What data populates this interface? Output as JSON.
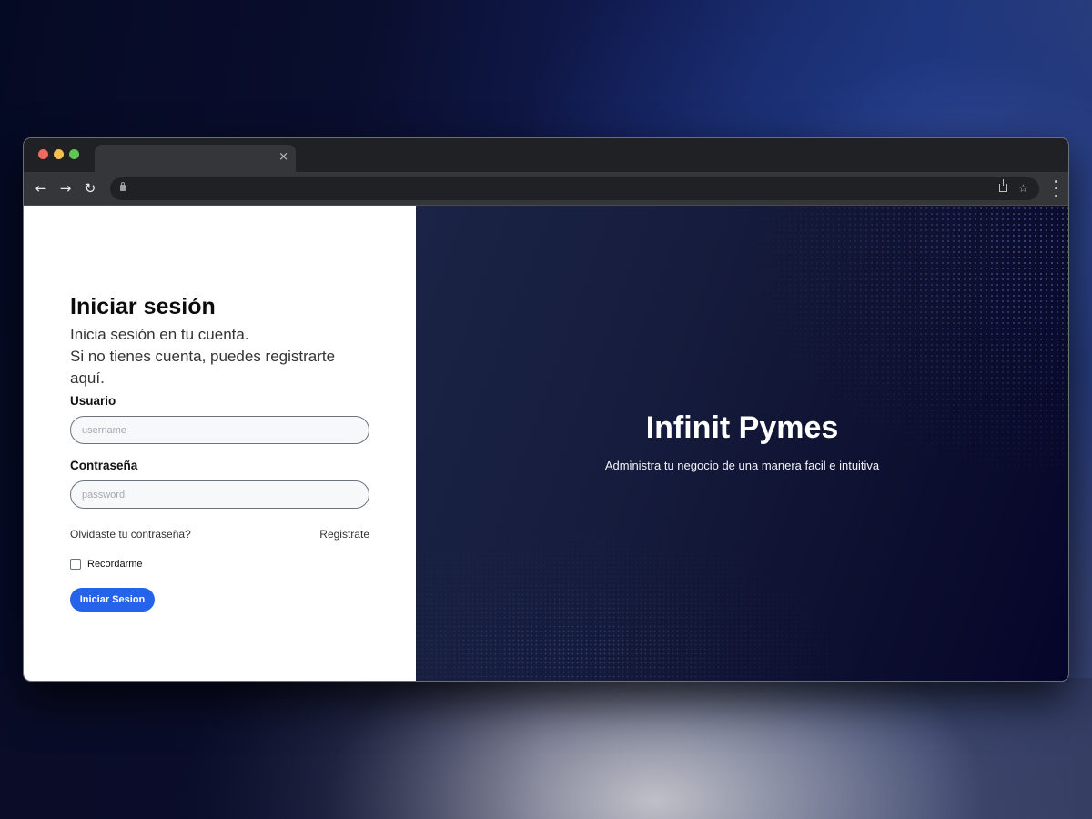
{
  "browser": {
    "tab": {
      "title": "",
      "close_icon": "×"
    },
    "nav": {
      "back_icon": "←",
      "forward_icon": "→",
      "reload_icon": "↻"
    },
    "address_bar": {
      "url": "",
      "lock_icon": "lock-icon"
    },
    "bookmark_icon": "☆"
  },
  "login": {
    "title": "Iniciar sesión",
    "subtitle_line1": "Inicia sesión en tu cuenta.",
    "subtitle_line2": "Si no tienes cuenta, puedes registrarte aquí.",
    "username_label": "Usuario",
    "username_placeholder": "username",
    "username_value": "",
    "password_label": "Contraseña",
    "password_placeholder": "password",
    "password_value": "",
    "forgot_link": "Olvidaste tu contraseña?",
    "register_link": "Registrate",
    "remember_label": "Recordarme",
    "remember_checked": false,
    "submit_label": "Iniciar Sesion"
  },
  "hero": {
    "title": "Infinit Pymes",
    "subtitle": "Administra tu negocio de una manera facil e intuitiva"
  },
  "colors": {
    "primary_button": "#2563eb",
    "hero_background": "#0e1030"
  }
}
